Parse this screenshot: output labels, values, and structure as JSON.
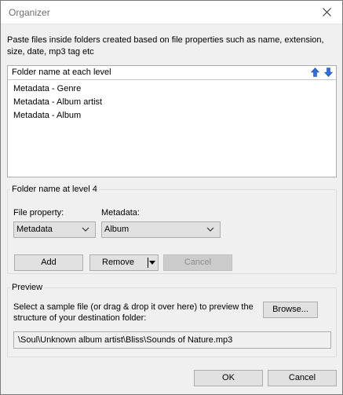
{
  "window": {
    "title": "Organizer"
  },
  "description": "Paste files inside folders created based on file properties such as name, extension, size, date, mp3 tag etc",
  "folder_list": {
    "header": "Folder name at each level",
    "items": [
      "Metadata - Genre",
      "Metadata - Album artist",
      "Metadata - Album"
    ]
  },
  "level_group": {
    "legend": "Folder name at level 4",
    "file_property_label": "File property:",
    "file_property_value": "Metadata",
    "metadata_label": "Metadata:",
    "metadata_value": "Album",
    "add_label": "Add",
    "remove_label": "Remove",
    "cancel_label": "Cancel"
  },
  "preview_group": {
    "legend": "Preview",
    "instruction": "Select a sample file (or drag & drop it over here) to preview the structure of your destination folder:",
    "browse_label": "Browse...",
    "path": "\\Soul\\Unknown album artist\\Bliss\\Sounds of Nature.mp3"
  },
  "footer": {
    "ok_label": "OK",
    "cancel_label": "Cancel"
  },
  "colors": {
    "arrow_blue": "#2f6fd6",
    "focus_blue": "#0078d7"
  },
  "icons": {
    "close": "close-icon",
    "up": "arrow-up-icon",
    "down": "arrow-down-icon",
    "chevron": "chevron-down-icon"
  }
}
